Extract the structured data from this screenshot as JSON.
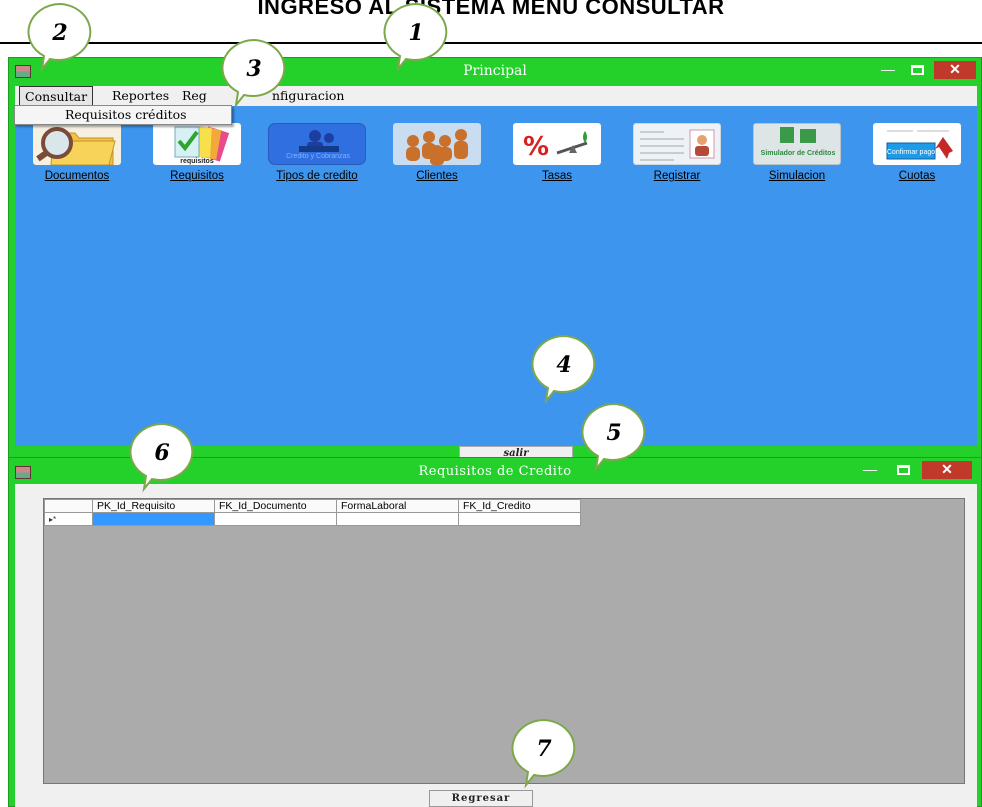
{
  "document": {
    "title": "INGRESO AL SISTEMA MENU CONSULTAR"
  },
  "main_window": {
    "title": "Principal",
    "controls": {
      "minimize": "—",
      "close": "✕"
    },
    "menu": [
      "Consultar",
      "Reportes",
      "Reg",
      "nfiguracion"
    ],
    "dropdown_item": "Requisitos créditos",
    "tiles": [
      {
        "label": "Documentos",
        "icon": "folder-magnifier-icon"
      },
      {
        "label": "Requisitos",
        "icon": "requisitos-cards-icon",
        "caption": "requisitos"
      },
      {
        "label": "Tipos de credito",
        "icon": "credito-cobranzas-icon",
        "caption": "Credito y Cobranzas"
      },
      {
        "label": "Clientes",
        "icon": "clients-group-icon"
      },
      {
        "label": "Tasas",
        "icon": "percent-scale-icon"
      },
      {
        "label": "Registrar",
        "icon": "register-form-icon"
      },
      {
        "label": "Simulacion",
        "icon": "simulador-creditos-icon",
        "caption": "Simulador de Créditos"
      },
      {
        "label": "Cuotas",
        "icon": "confirm-payment-icon",
        "caption": "Confirmar pago"
      }
    ],
    "exit_button": "salir"
  },
  "req_window": {
    "title": "Requisitos de Credito",
    "controls": {
      "minimize": "—",
      "close": "✕"
    },
    "grid": {
      "row_marker": "▸*",
      "columns": [
        "PK_Id_Requisito",
        "FK_Id_Documento",
        "FormaLaboral",
        "FK_Id_Credito"
      ]
    },
    "back_button": "Regresar"
  },
  "callouts": [
    "1",
    "2",
    "3",
    "4",
    "5",
    "6",
    "7"
  ],
  "colors": {
    "window_frame": "#24d12b",
    "client_blue": "#3d95ee",
    "grid_gray": "#ababab",
    "selection": "#3399ff"
  }
}
